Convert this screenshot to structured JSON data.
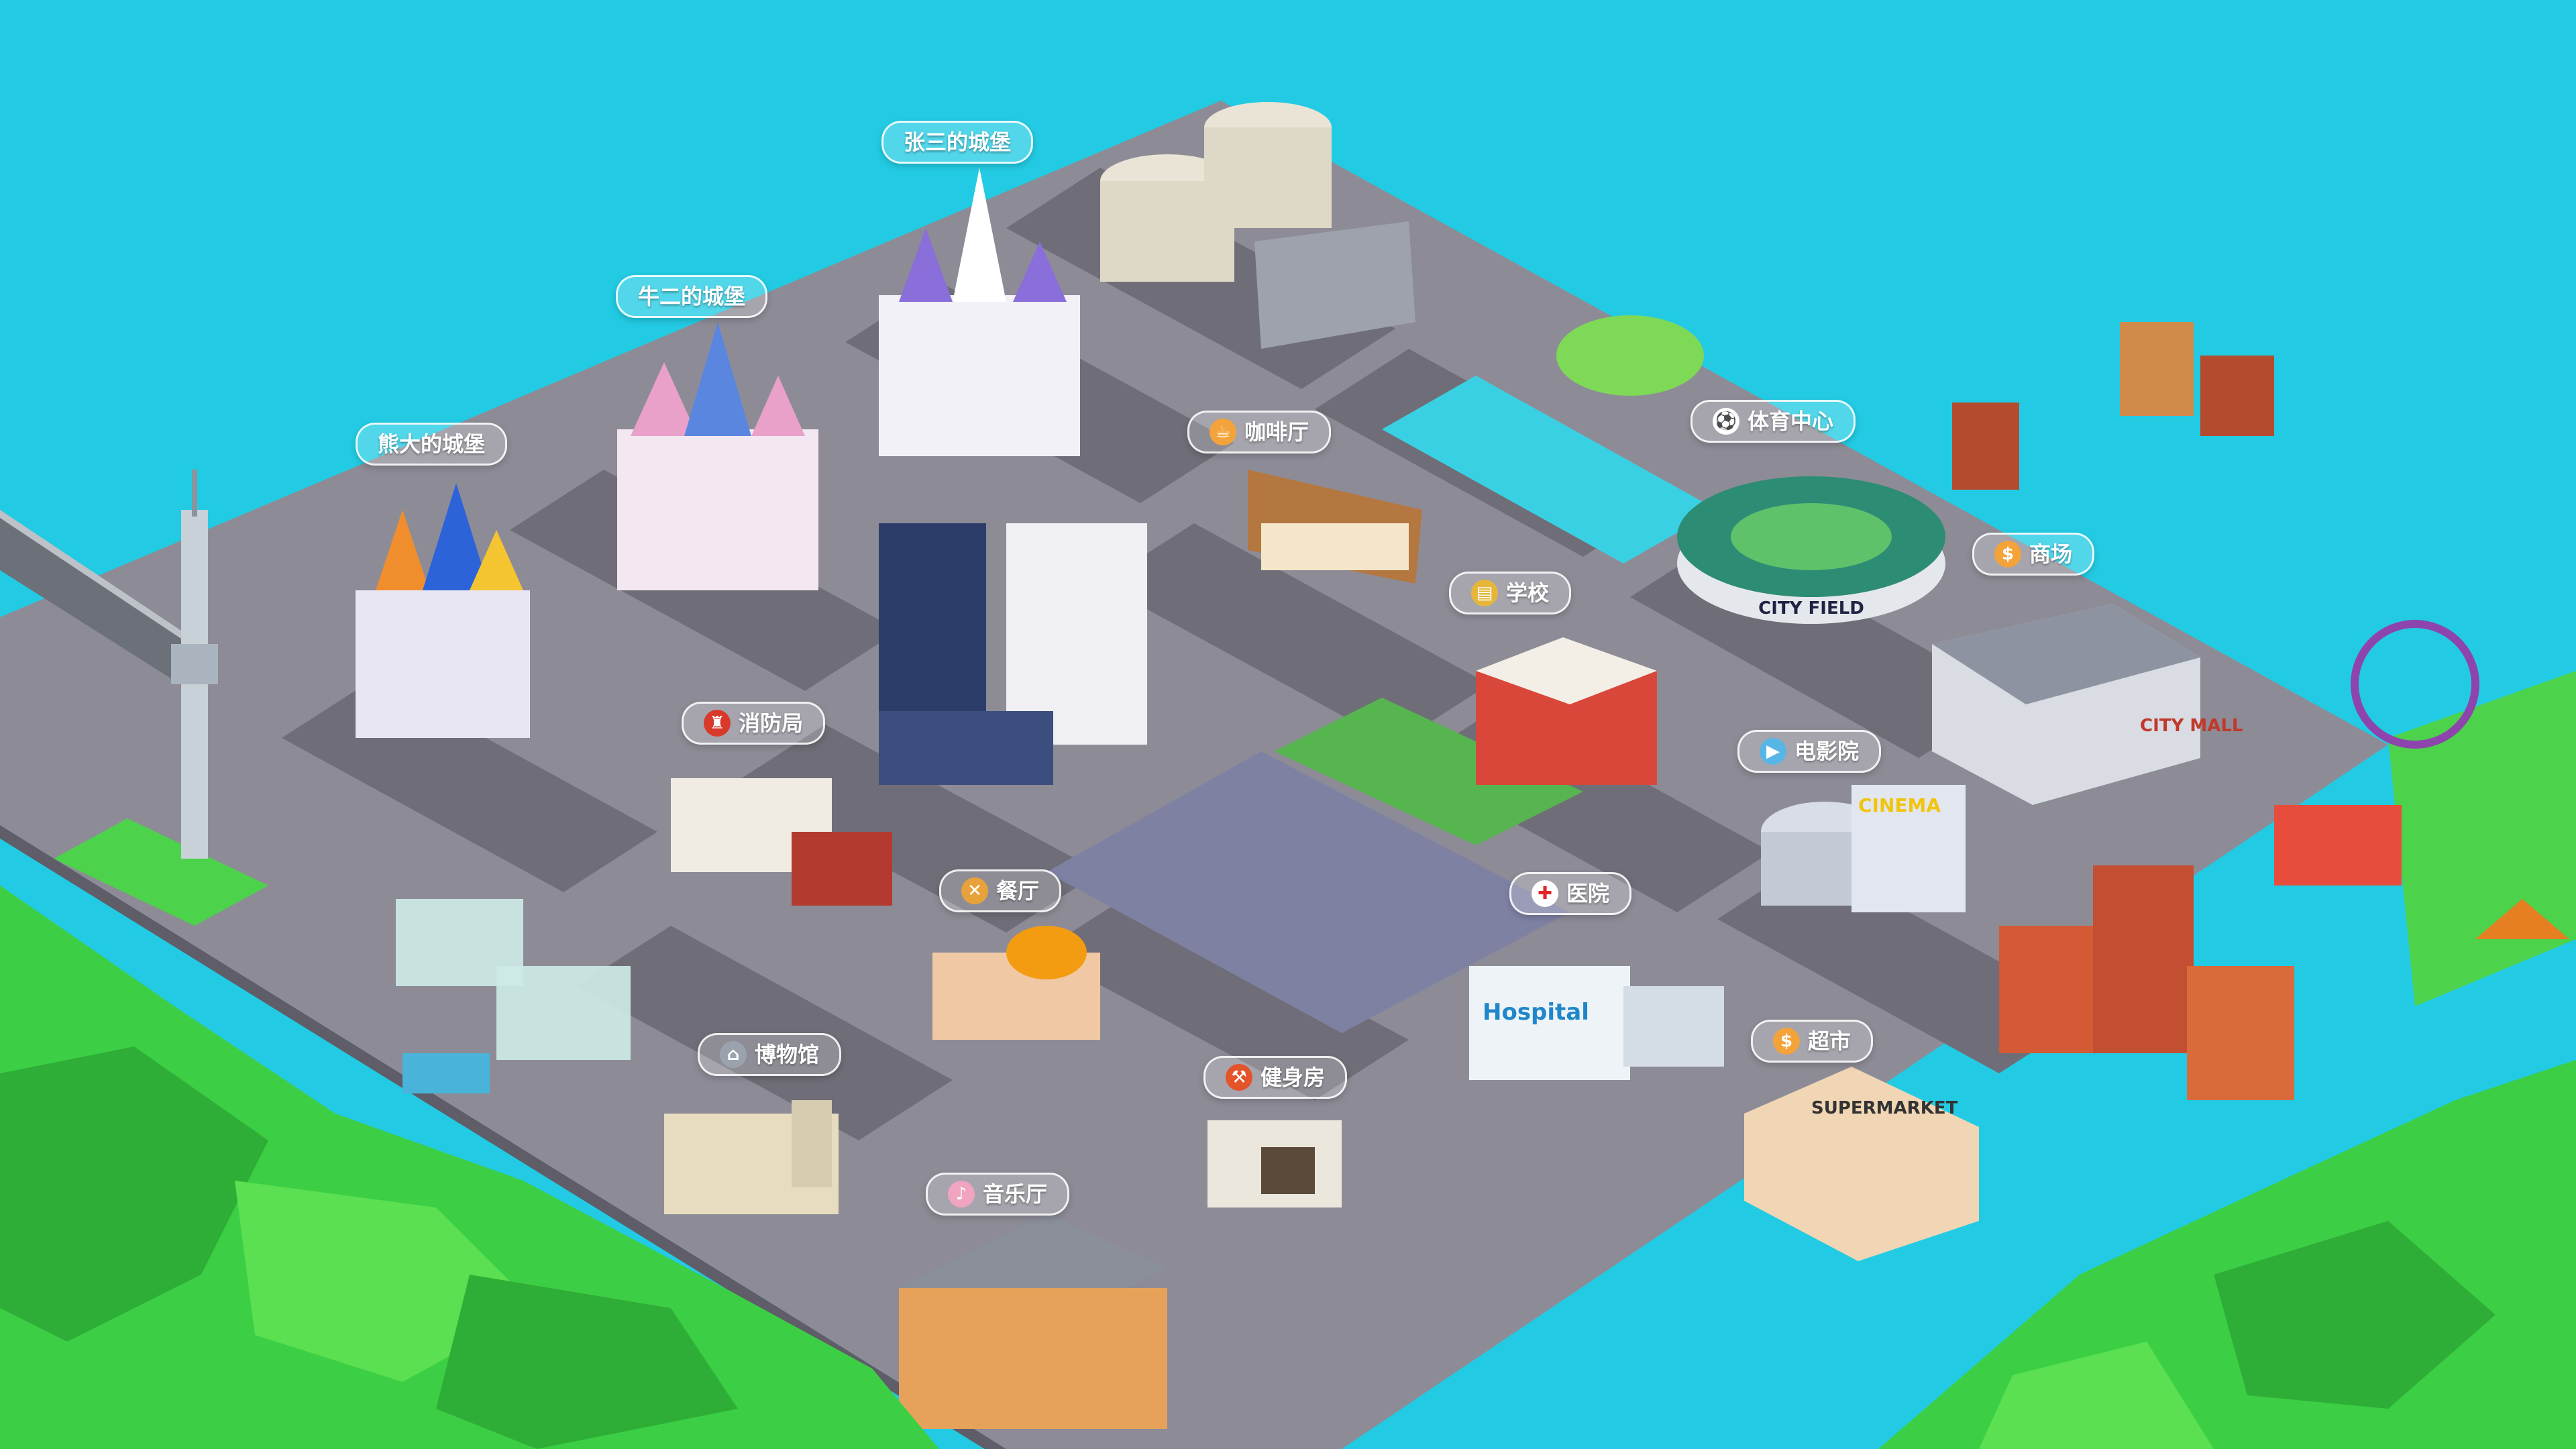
{
  "map": {
    "colors": {
      "sea": "#22cbe3",
      "road": "#8d8c96",
      "block": "#6f6e78",
      "grass": "#4cd24b",
      "hill": "#3ccf45",
      "plaza": "#7f81a3"
    }
  },
  "labels": [
    {
      "key": "castle-zhangsan",
      "text": "张三的城堡",
      "icon": ""
    },
    {
      "key": "castle-niuer",
      "text": "牛二的城堡",
      "icon": ""
    },
    {
      "key": "castle-xiongda",
      "text": "熊大的城堡",
      "icon": ""
    },
    {
      "key": "cafe",
      "text": "咖啡厅",
      "icon": "coffee-icon"
    },
    {
      "key": "sports-center",
      "text": "体育中心",
      "icon": "soccer-ball-icon"
    },
    {
      "key": "mall",
      "text": "商场",
      "icon": "coin-icon"
    },
    {
      "key": "school",
      "text": "学校",
      "icon": "books-icon"
    },
    {
      "key": "fire-station",
      "text": "消防局",
      "icon": "fire-hydrant-icon"
    },
    {
      "key": "cinema",
      "text": "电影院",
      "icon": "clapper-icon"
    },
    {
      "key": "restaurant",
      "text": "餐厅",
      "icon": "utensils-icon"
    },
    {
      "key": "hospital",
      "text": "医院",
      "icon": "red-cross-icon"
    },
    {
      "key": "museum",
      "text": "博物馆",
      "icon": "museum-icon"
    },
    {
      "key": "gym",
      "text": "健身房",
      "icon": "dumbbell-icon"
    },
    {
      "key": "supermarket",
      "text": "超市",
      "icon": "coin-icon"
    },
    {
      "key": "concert-hall",
      "text": "音乐厅",
      "icon": "music-icon"
    }
  ],
  "signs": {
    "city_field": "CITY FIELD",
    "city_mall": "CITY MALL",
    "cinema": "CINEMA",
    "hospital": "Hospital",
    "supermarket": "SUPERMARKET"
  }
}
